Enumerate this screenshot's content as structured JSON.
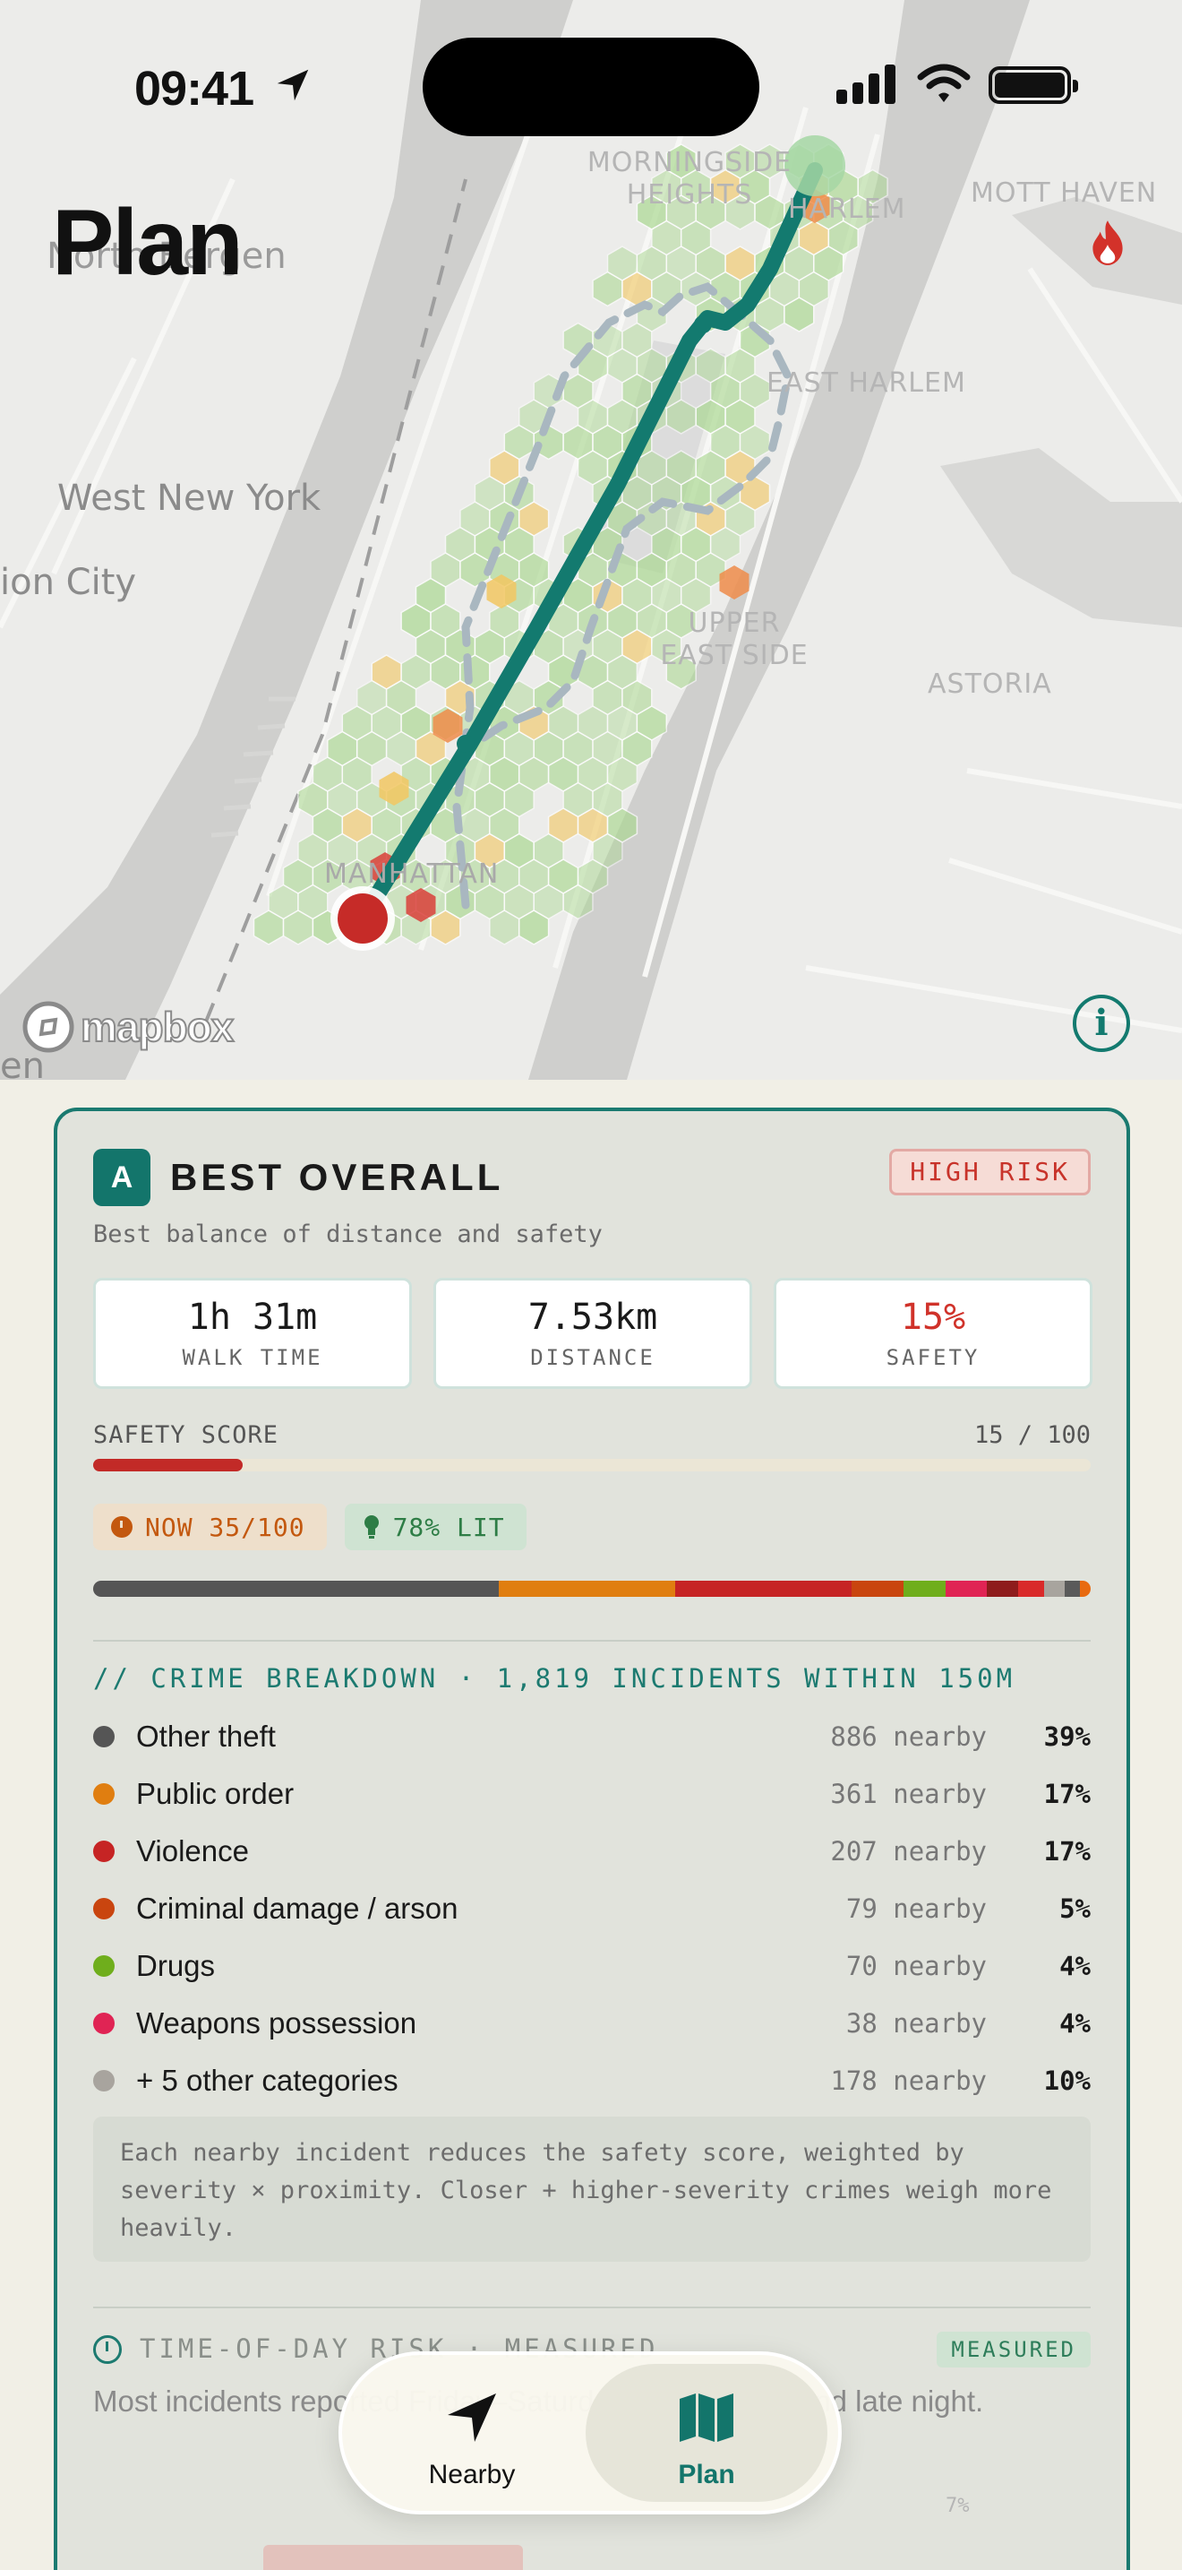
{
  "status_bar": {
    "time": "09:41"
  },
  "map": {
    "page_title": "Plan",
    "places": {
      "morningside": "MORNINGSIDE\nHEIGHTS",
      "harlem": "HARLEM",
      "mott_haven": "MOTT HAVEN",
      "north_bergen": "North Bergen",
      "east_harlem": "EAST HARLEM",
      "west_new_york": "West New York",
      "union_city": "ion City",
      "upper_east_side": "UPPER\nEAST SIDE",
      "astoria": "ASTORIA",
      "manhattan": "MANHATTAN",
      "edge": "en"
    },
    "attribution": "mapbox",
    "info_label": "i",
    "route_color": "#137a6f",
    "hex_colors": {
      "safe": "#a9d88f",
      "caution": "#f2c761",
      "warning": "#ef8c4a",
      "danger": "#d9403a"
    }
  },
  "route_card": {
    "badge": "A",
    "title": "BEST OVERALL",
    "risk_label": "HIGH RISK",
    "subtitle": "Best balance of distance and safety",
    "stats": [
      {
        "value": "1h 31m",
        "label": "WALK TIME"
      },
      {
        "value": "7.53km",
        "label": "DISTANCE"
      },
      {
        "value": "15%",
        "label": "SAFETY"
      }
    ],
    "safety_score_label": "SAFETY SCORE",
    "safety_score_text": "15 / 100",
    "safety_score_value": 15,
    "safety_score_max": 100,
    "chips": {
      "now": "NOW 35/100",
      "lit": "78% LIT"
    },
    "breakdown_header": "// CRIME BREAKDOWN · 1,819 INCIDENTS WITHIN 150M",
    "crimes": [
      {
        "name": "Other theft",
        "count": "886 nearby",
        "pct": "39%",
        "color": "#555555"
      },
      {
        "name": "Public order",
        "count": "361 nearby",
        "pct": "17%",
        "color": "#e07e10"
      },
      {
        "name": "Violence",
        "count": "207 nearby",
        "pct": "17%",
        "color": "#c62424"
      },
      {
        "name": "Criminal damage / arson",
        "count": "79 nearby",
        "pct": "5%",
        "color": "#c9450f"
      },
      {
        "name": "Drugs",
        "count": "70 nearby",
        "pct": "4%",
        "color": "#6fae1c"
      },
      {
        "name": "Weapons possession",
        "count": "38 nearby",
        "pct": "4%",
        "color": "#e02454"
      },
      {
        "name": "+ 5 other categories",
        "count": "178 nearby",
        "pct": "10%",
        "color": "#a8a49e"
      }
    ],
    "segments": [
      {
        "weight": 39,
        "color": "#555555"
      },
      {
        "weight": 17,
        "color": "#e07e10"
      },
      {
        "weight": 17,
        "color": "#c62424"
      },
      {
        "weight": 5,
        "color": "#c9450f"
      },
      {
        "weight": 4,
        "color": "#6fae1c"
      },
      {
        "weight": 4,
        "color": "#e02454"
      },
      {
        "weight": 3,
        "color": "#8e1c1c"
      },
      {
        "weight": 2.5,
        "color": "#d92a2a"
      },
      {
        "weight": 2,
        "color": "#a8a49e"
      },
      {
        "weight": 1.5,
        "color": "#5a5a5a"
      },
      {
        "weight": 1,
        "color": "#e86a10"
      }
    ],
    "note": "Each nearby incident reduces the safety score, weighted by severity × proximity. Closer + higher-severity crimes weigh more heavily.",
    "time_of_day": {
      "header": "TIME-OF-DAY RISK · MEASURED",
      "badge": "MEASURED",
      "text": "Most incidents reported Friday–Saturday nights, weekend late night.",
      "pct_label": "7%"
    }
  },
  "tab_bar": {
    "tabs": [
      {
        "label": "Nearby",
        "selected": false
      },
      {
        "label": "Plan",
        "selected": true
      }
    ]
  }
}
